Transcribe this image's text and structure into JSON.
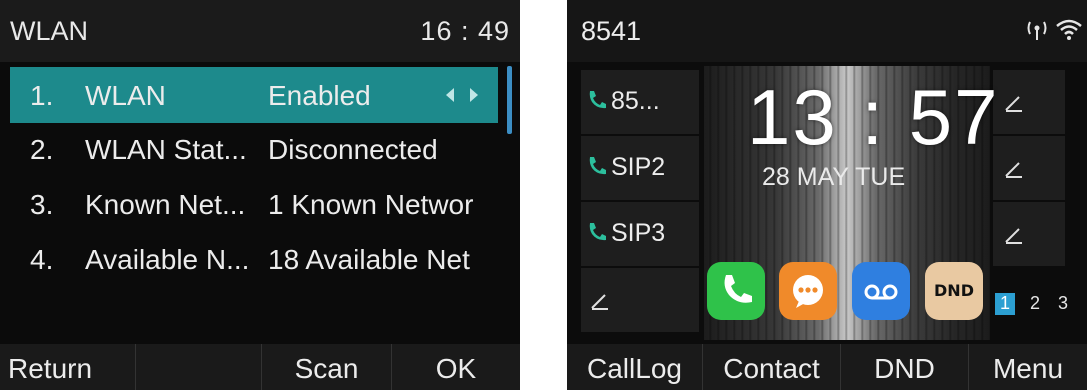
{
  "wlan_screen": {
    "title": "WLAN",
    "time": "16 : 49",
    "items": [
      {
        "num": "1.",
        "name": "WLAN",
        "value": "Enabled"
      },
      {
        "num": "2.",
        "name": "WLAN Stat...",
        "value": "Disconnected"
      },
      {
        "num": "3.",
        "name": "Known Net...",
        "value": "1 Known Networ"
      },
      {
        "num": "4.",
        "name": "Available N...",
        "value": "18 Available Net"
      }
    ],
    "softkeys": [
      "Return",
      "",
      "Scan",
      "OK"
    ],
    "accent_color": "#1d8a8c",
    "scrollbar_color": "#3c8ec4",
    "icons": {
      "switch": "left-right-arrows-icon"
    }
  },
  "home_screen": {
    "extension": "8541",
    "status_icons": [
      "antenna-icon",
      "wifi-icon"
    ],
    "line_keys": [
      {
        "label": "85...",
        "icon": "phone-handset-icon"
      },
      {
        "label": "SIP2",
        "icon": "phone-handset-icon"
      },
      {
        "label": "SIP3",
        "icon": "phone-handset-icon"
      },
      {
        "label": "",
        "icon": "pencil-icon"
      }
    ],
    "right_keys": [
      {
        "icon": "pencil-icon"
      },
      {
        "icon": "pencil-icon"
      },
      {
        "icon": "pencil-icon"
      }
    ],
    "clock": "13 : 57",
    "date": "28 MAY TUE",
    "apps": [
      {
        "name": "phone-app-icon",
        "color": "#2fc24a"
      },
      {
        "name": "messages-app-icon",
        "color": "#f08a2a"
      },
      {
        "name": "voicemail-app-icon",
        "color": "#2f7fe0"
      },
      {
        "name": "dnd-app-icon",
        "label": "DND",
        "color": "#e9c9a2"
      }
    ],
    "pages": [
      "1",
      "2",
      "3"
    ],
    "active_page": "1",
    "softkeys": [
      "CallLog",
      "Contact",
      "DND",
      "Menu"
    ]
  }
}
